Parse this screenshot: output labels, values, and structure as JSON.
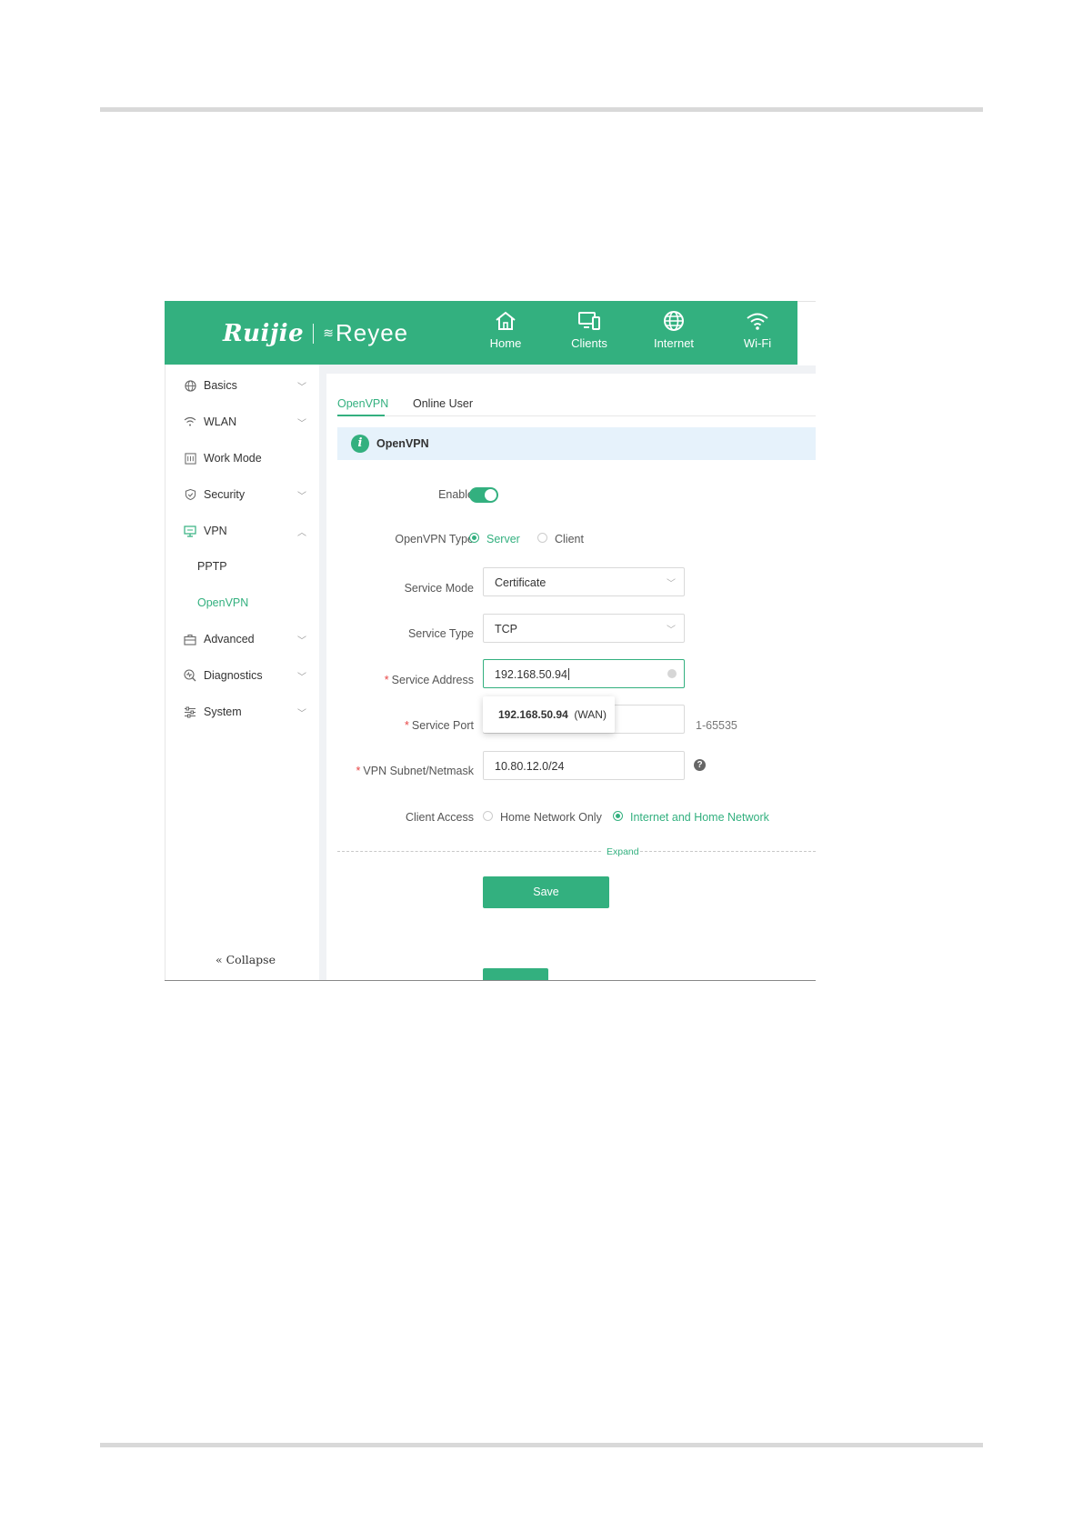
{
  "brand": {
    "logo_text": "Ruijie",
    "product": "Reyee"
  },
  "topnav": [
    {
      "label": "Home",
      "icon": "home-icon"
    },
    {
      "label": "Clients",
      "icon": "devices-icon"
    },
    {
      "label": "Internet",
      "icon": "globe-icon"
    },
    {
      "label": "Wi-Fi",
      "icon": "wifi-icon"
    }
  ],
  "sidebar": {
    "items": [
      {
        "label": "Basics",
        "icon": "globe-icon",
        "expandable": true
      },
      {
        "label": "WLAN",
        "icon": "wifi-icon",
        "expandable": true
      },
      {
        "label": "Work Mode",
        "icon": "workmode-icon",
        "expandable": false
      },
      {
        "label": "Security",
        "icon": "shield-icon",
        "expandable": true
      },
      {
        "label": "VPN",
        "icon": "monitor-icon",
        "expandable": true,
        "expanded": true
      },
      {
        "label": "Advanced",
        "icon": "toolbox-icon",
        "expandable": true
      },
      {
        "label": "Diagnostics",
        "icon": "diagnostics-icon",
        "expandable": true
      },
      {
        "label": "System",
        "icon": "sliders-icon",
        "expandable": true
      }
    ],
    "vpn_children": [
      "PPTP",
      "OpenVPN"
    ],
    "active_child": "OpenVPN",
    "collapse_label": "« Collapse"
  },
  "tabs": [
    {
      "label": "OpenVPN",
      "active": true
    },
    {
      "label": "Online User",
      "active": false
    }
  ],
  "banner": {
    "title": "OpenVPN"
  },
  "form": {
    "enable_label": "Enable",
    "enable_on": true,
    "type_label": "OpenVPN Type",
    "type_options": [
      "Server",
      "Client"
    ],
    "type_selected": "Server",
    "service_mode_label": "Service Mode",
    "service_mode_value": "Certificate",
    "service_type_label": "Service Type",
    "service_type_value": "TCP",
    "service_address_label": "Service Address",
    "service_address_value": "192.168.50.94",
    "address_suggestion_ip": "192.168.50.94",
    "address_suggestion_tag": "(WAN)",
    "service_port_label": "Service Port",
    "service_port_hint": "1-65535",
    "subnet_label": "VPN Subnet/Netmask",
    "subnet_value": "10.80.12.0/24",
    "client_access_label": "Client Access",
    "client_access_options": [
      "Home Network Only",
      "Internet and Home Network"
    ],
    "client_access_selected": "Internet and Home Network",
    "expand_label": "Expand",
    "save_label": "Save",
    "required_mark": "*",
    "help_mark": "?"
  },
  "colors": {
    "brand_green": "#33b07f",
    "banner_bg": "#e6f2fb",
    "required_red": "#e84545"
  }
}
